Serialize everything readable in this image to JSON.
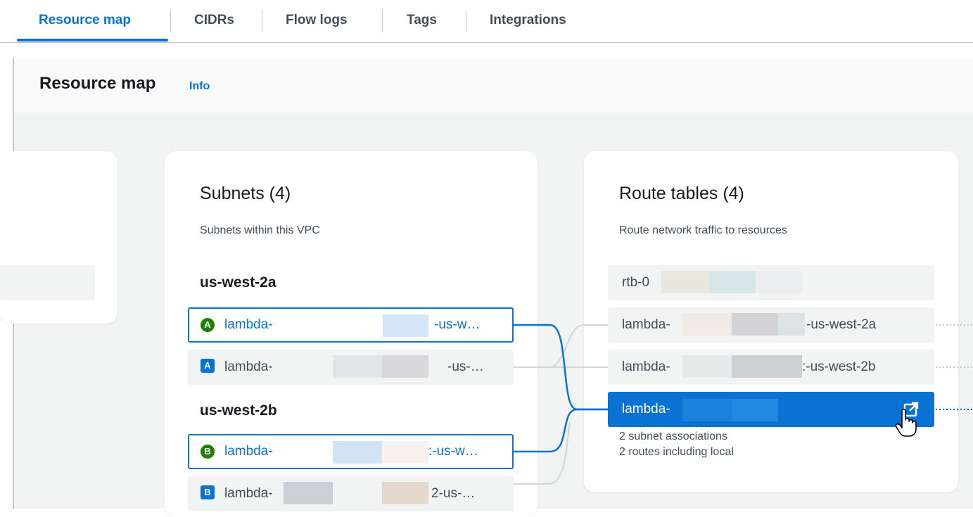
{
  "tabs": [
    {
      "label": "Resource map",
      "active": true
    },
    {
      "label": "CIDRs",
      "active": false
    },
    {
      "label": "Flow logs",
      "active": false
    },
    {
      "label": "Tags",
      "active": false
    },
    {
      "label": "Integrations",
      "active": false
    }
  ],
  "header": {
    "title": "Resource map",
    "info": "Info"
  },
  "subnets": {
    "title": "Subnets (4)",
    "description": "Subnets within this VPC",
    "zones": [
      {
        "label": "us-west-2a",
        "items": [
          {
            "badge": "A",
            "prefix": "lambda-",
            "suffix": "-us-w…",
            "selected": true
          },
          {
            "badge": "A",
            "prefix": "lambda-",
            "suffix": "-us-…",
            "selected": false
          }
        ]
      },
      {
        "label": "us-west-2b",
        "items": [
          {
            "badge": "B",
            "prefix": "lambda-",
            "suffix": ":-us-w…",
            "selected": true
          },
          {
            "badge": "B",
            "prefix": "lambda-",
            "suffix": "2-us-…",
            "selected": false
          }
        ]
      }
    ]
  },
  "route_tables": {
    "title": "Route tables (4)",
    "description": "Route network traffic to resources",
    "items": [
      {
        "prefix": "rtb-0",
        "suffix": ""
      },
      {
        "prefix": "lambda-",
        "suffix": "-us-west-2a"
      },
      {
        "prefix": "lambda-",
        "suffix": ":-us-west-2b"
      },
      {
        "prefix": "lambda-",
        "suffix": "",
        "active": true
      }
    ],
    "active_details": [
      "2 subnet associations",
      "2 routes including local"
    ]
  },
  "icons": {
    "external_link": "external-link-icon",
    "cursor": "hand-pointer-icon"
  },
  "colors": {
    "accent": "#0972d3",
    "available": "#1d8102",
    "text": "#16191f",
    "muted": "#414d5c"
  }
}
